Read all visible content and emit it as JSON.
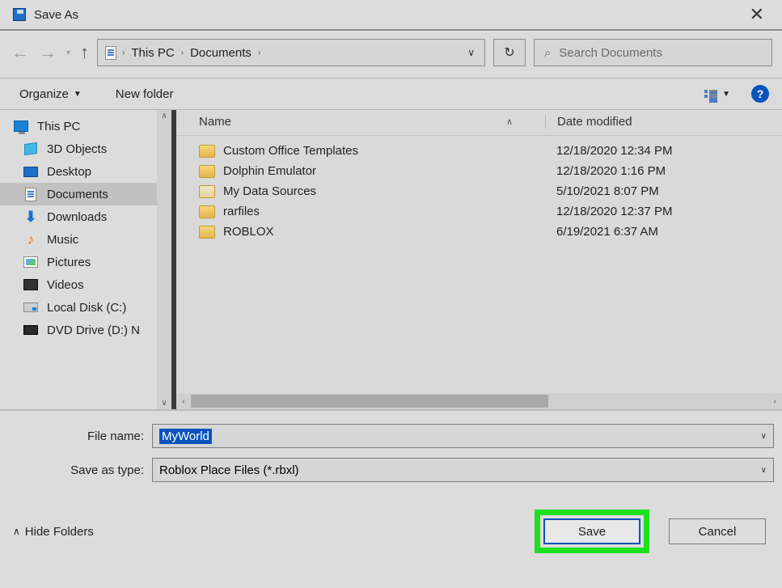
{
  "title": "Save As",
  "breadcrumb": {
    "pc": "This PC",
    "folder": "Documents"
  },
  "search": {
    "placeholder": "Search Documents"
  },
  "toolbar": {
    "organize": "Organize",
    "newfolder": "New folder"
  },
  "nav": {
    "root": "This PC",
    "items": [
      "3D Objects",
      "Desktop",
      "Documents",
      "Downloads",
      "Music",
      "Pictures",
      "Videos",
      "Local Disk (C:)",
      "DVD Drive (D:) N"
    ]
  },
  "columns": {
    "name": "Name",
    "date": "Date modified"
  },
  "files": [
    {
      "name": "Custom Office Templates",
      "date": "12/18/2020 12:34 PM",
      "type": "folder"
    },
    {
      "name": "Dolphin Emulator",
      "date": "12/18/2020 1:16 PM",
      "type": "folder"
    },
    {
      "name": "My Data Sources",
      "date": "5/10/2021 8:07 PM",
      "type": "data"
    },
    {
      "name": "rarfiles",
      "date": "12/18/2020 12:37 PM",
      "type": "folder"
    },
    {
      "name": "ROBLOX",
      "date": "6/19/2021 6:37 AM",
      "type": "folder"
    }
  ],
  "form": {
    "filename_label": "File name:",
    "filename_value": "MyWorld",
    "type_label": "Save as type:",
    "type_value": "Roblox Place Files (*.rbxl)"
  },
  "footer": {
    "hide": "Hide Folders",
    "save": "Save",
    "cancel": "Cancel"
  }
}
